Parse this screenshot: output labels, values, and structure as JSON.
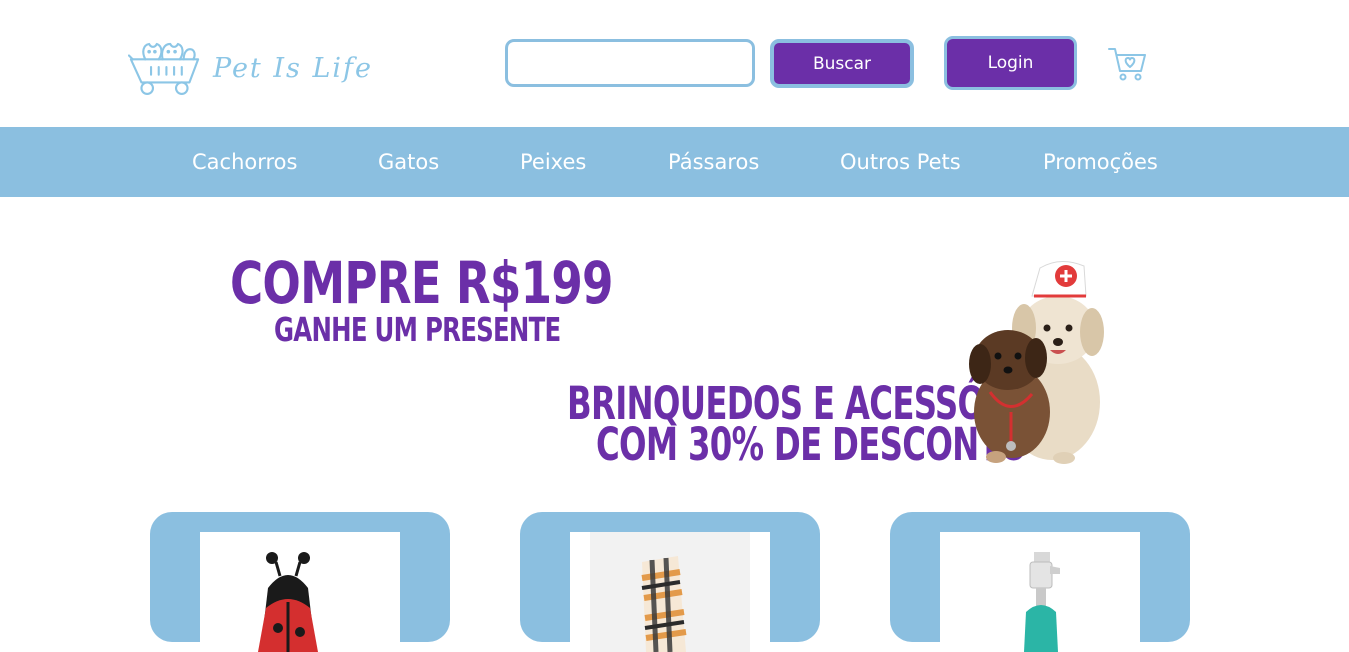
{
  "brand": {
    "name": "Pet Is Life"
  },
  "search": {
    "placeholder": "",
    "button_label": "Buscar"
  },
  "auth": {
    "login_label": "Login"
  },
  "cart": {
    "icon": "shopping-cart-heart-icon"
  },
  "nav": {
    "items": [
      {
        "label": "Cachorros"
      },
      {
        "label": "Gatos"
      },
      {
        "label": "Peixes"
      },
      {
        "label": "Pássaros"
      },
      {
        "label": "Outros Pets"
      },
      {
        "label": "Promoções"
      }
    ]
  },
  "banner": {
    "headline": "COMPRE R$199",
    "subheadline": "GANHE UM PRESENTE",
    "offer_line1": "BRINQUEDOS E ACESSÓRIOS",
    "offer_line2": "COM 30% DE DESCONTO"
  },
  "products": [
    {
      "image": "dog-costume-ladybug"
    },
    {
      "image": "plaid-pet-blanket"
    },
    {
      "image": "pet-spray-bottle"
    }
  ],
  "colors": {
    "accent": "#6b2fa8",
    "nav_bg": "#8bbfe0",
    "logo": "#8cc6e6",
    "background": "#ffffff"
  }
}
